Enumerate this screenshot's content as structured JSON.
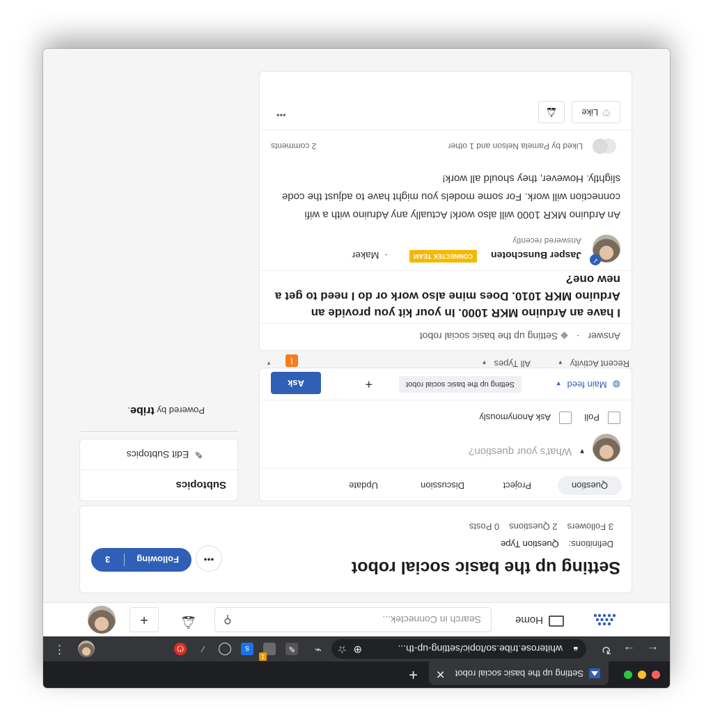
{
  "browser": {
    "tab_title": "Setting up the basic social robot",
    "close_glyph": "✕",
    "new_tab_glyph": "+",
    "url": "whiterose.tribe.so/topic/setting-up-th...",
    "extension_badge": "1"
  },
  "site": {
    "home_label": "Home",
    "search_placeholder": "Search in Connectek...",
    "create_glyph": "+"
  },
  "topic": {
    "title": "Setting up the basic social robot",
    "definitions_label": "Definitions:",
    "definitions_value": "Question Type",
    "followers": "3 Followers",
    "questions": "2 Questions",
    "posts": "0 Posts",
    "following_label": "Following",
    "following_count": "3",
    "more_glyph": "•••"
  },
  "composer": {
    "tabs": [
      "Question",
      "Project",
      "Discussion",
      "Update"
    ],
    "placeholder": "What's your question?",
    "poll_label": "Poll",
    "anonymous_label": "Ask Anonymously",
    "feed_label": "Main feed",
    "topic_pill": "Setting up the basic social robot",
    "add_glyph": "+",
    "ask_label": "Ask"
  },
  "filters": {
    "recent": "Recent Activity",
    "types": "All Types"
  },
  "sidebar": {
    "subtopics_title": "Subtopics",
    "edit_subtopics": "Edit Subtopics",
    "powered_by": "Powered by",
    "brand": "tribe"
  },
  "post": {
    "type": "Answer",
    "topic": "Setting up the basic social robot",
    "question": "I have an Arduino MKR 1000. In your kit you provide an Arduino MKR 1010. Does mine also work or do I need to get a new one?",
    "answerer": "Jasper Bunschoten",
    "badge": "CONNECTEK TEAM",
    "role": "Maker",
    "answered": "Answered recently",
    "answer": "An Arduino MKR 1000 will also work! Actually any Adruino with a wifi connection will work. For some models you might have to adjust the code slightly. However, they should all work!",
    "likes": "Liked by Pamela Nelson and 1 other",
    "comments": "2 comments",
    "like_label": "Like",
    "more_glyph": "•••"
  },
  "colors": {
    "accent": "#2f5fb6",
    "badge": "#f5b800",
    "rss": "#f57c1f"
  }
}
